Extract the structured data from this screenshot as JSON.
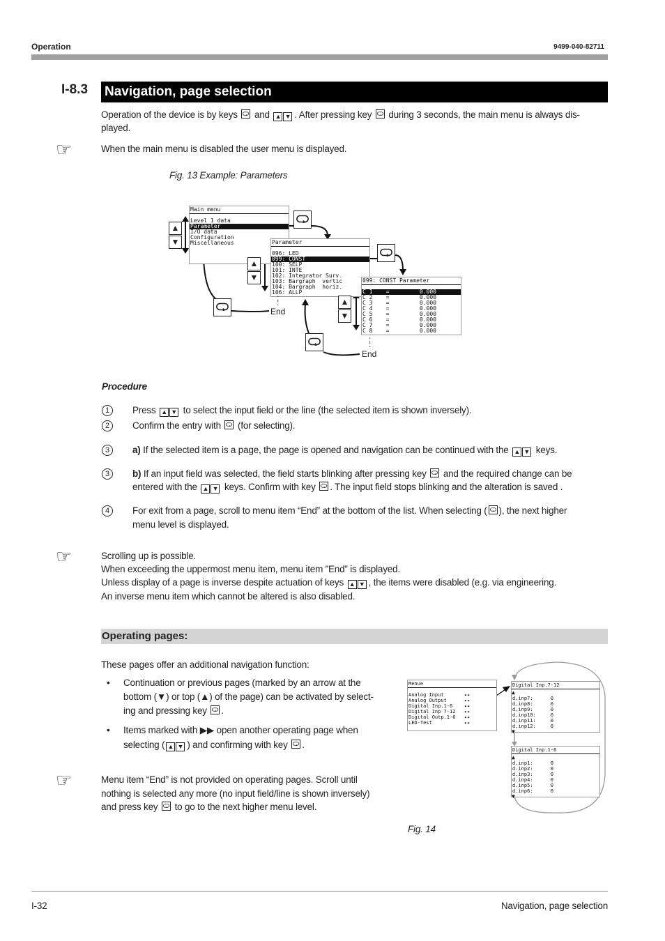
{
  "header": {
    "left": "Operation",
    "right": "9499-040-82711"
  },
  "section": {
    "number": "I-8.3",
    "title": "Navigation, page selection"
  },
  "intro": {
    "p1": [
      "Operation of the device is by keys",
      "and",
      ". After pressing key",
      "during 3 seconds, the main menu is always dis-",
      "played."
    ],
    "note": "When the main menu is disabled the user menu is displayed."
  },
  "fig13": {
    "caption": "Fig. 13  Example: Parameters",
    "main_menu": {
      "title": "Main menu",
      "items": [
        "Level 1 data",
        "Parameter",
        "I/O data",
        "Configuration",
        "Miscellaneous"
      ],
      "selected": 1
    },
    "parameter": {
      "title": "Parameter",
      "items": [
        "096: LED",
        "099: CONST",
        "100: SELP",
        "101: INTE",
        "102: Integrator Surv.",
        "103: Bargraph  vertic",
        "104: Bargraph  horiz.",
        "106: ALLP"
      ],
      "selected": 1
    },
    "const": {
      "title": "099: CONST  Parameter",
      "items": [
        "C 1    =         0.000",
        "C 2    =         0.000",
        "C 3    =         0.000",
        "C 4    =         0.000",
        "C 5    =         0.000",
        "C 6    =         0.000",
        "C 7    =         0.000",
        "C 8    =         0.000"
      ],
      "selected": 0
    },
    "end_label": "End",
    "dots": ":"
  },
  "procedure": {
    "title": "Procedure",
    "s1": {
      "n": "1",
      "a": "Press",
      "b": "to select the input field or the line (the selected item is shown inversely)."
    },
    "s2": {
      "n": "2",
      "a": "Confirm the entry with",
      "b": "(for selecting)."
    },
    "s3a": {
      "n": "3",
      "lbl": "a)",
      "a": "If the selected item is a page, the page is opened and navigation can be continued with the",
      "b": "keys."
    },
    "s3b": {
      "n": "3",
      "lbl": "b)",
      "a": "If an input field was selected, the field starts blinking after pressing key",
      "b": "and the required change can be",
      "c": "entered with the",
      "d": "keys. Confirm with key",
      "e": ". The input field stops blinking and the alteration is saved ."
    },
    "s4": {
      "n": "4",
      "a": "For exit from a page, scroll to menu item “End” at the bottom of the list. When selecting (",
      "b": "), the next higher",
      "c": "menu level is displayed."
    }
  },
  "note2": {
    "l1": "Scrolling up is possible.",
    "l2": "When exceeding the uppermost menu item, menu item ”End” is displayed.",
    "l3a": "Unless display of a page is inverse despite actuation of keys",
    "l3b": ", the items were disabled (e.g. via engineering.",
    "l4": "An inverse menu item which cannot be altered is also disabled."
  },
  "operating": {
    "title": "Operating pages:",
    "intro": "These pages offer an additional navigation function:",
    "b1": {
      "l1": "Continuation or previous pages (marked by an arrow at the",
      "l2a": "bottom (",
      "l2b": ") or top (",
      "l2c": ") of the page) can be activated by select-",
      "l3a": "ing and pressing key",
      "l3b": "."
    },
    "b2": {
      "l1a": "Items marked with",
      "l1b": "open another operating page when",
      "l2a": "selecting  (",
      "l2b": ") and confirming with key",
      "l2c": "."
    },
    "note": {
      "l1": "Menu item “End” is not provided on operating pages. Scroll until",
      "l2": "nothing is selected any more (no input field/line is shown inversely)",
      "l3a": "and press key",
      "l3b": "to go to the next higher menu level."
    }
  },
  "fig14": {
    "caption": "Fig. 14",
    "menue": {
      "title": "Menue",
      "items": [
        "Analog Input       ▸▸",
        "Analog Output      ▸▸",
        "Digital Inp.1-6    ▸▸",
        "Digital Inp 7-12   ▸▸",
        "Digital Outp.1-6   ▸▸",
        "LED-Test           ▸▸"
      ]
    },
    "di712": {
      "title": "Digital Inp.7-12",
      "items": [
        "d.inp7:      0",
        "d.inp8:      0",
        "d.inp9:      0",
        "d.inp10:     0",
        "d.inp11:     0",
        "d.inp12:     0"
      ]
    },
    "di16": {
      "title": "Digital Inp.1-6",
      "items": [
        "d.inp1:      0",
        "d.inp2:      0",
        "d.inp3:      0",
        "d.inp4:      0",
        "d.inp5:      0",
        "d.inp6:      0"
      ]
    }
  },
  "footer": {
    "left": "I-32",
    "right": "Navigation, page selection"
  },
  "colors": {
    "section_bar": "#000000",
    "header_rule": "#a0a0a0",
    "subsection_bar": "#d4d4d4"
  }
}
